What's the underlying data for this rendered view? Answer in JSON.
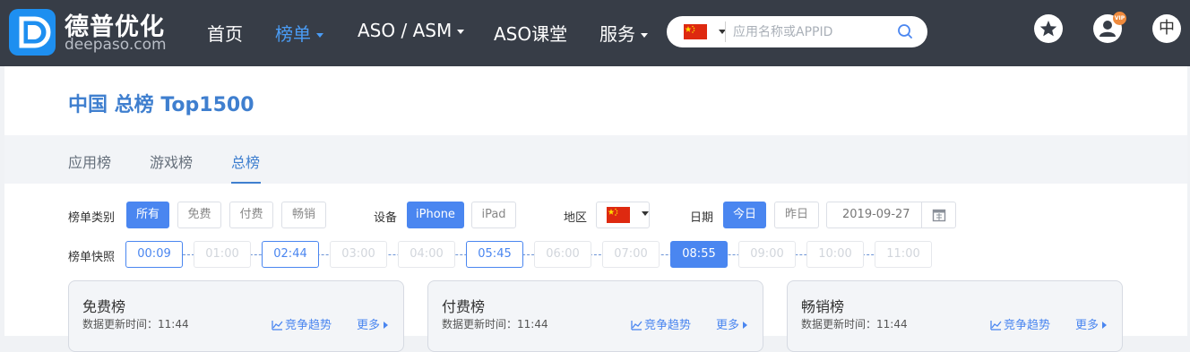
{
  "header": {
    "logo_cn": "德普优化",
    "logo_en": "deepaso.com",
    "nav": [
      {
        "label": "首页"
      },
      {
        "label": "榜单"
      },
      {
        "label": "ASO / ASM"
      },
      {
        "label": "ASO课堂"
      },
      {
        "label": "服务"
      }
    ],
    "search_placeholder": "应用名称或APPID",
    "vip_badge": "VIP",
    "lang": "中"
  },
  "page": {
    "title": "中国 总榜 Top1500",
    "tabs": [
      {
        "label": "应用榜"
      },
      {
        "label": "游戏榜"
      },
      {
        "label": "总榜"
      }
    ]
  },
  "filters": {
    "type_label": "榜单类别",
    "type_options": [
      "所有",
      "免费",
      "付费",
      "畅销"
    ],
    "device_label": "设备",
    "device_options": [
      "iPhone",
      "iPad"
    ],
    "region_label": "地区",
    "date_label": "日期",
    "date_options": [
      "今日",
      "昨日"
    ],
    "date_value": "2019-09-27"
  },
  "snapshot": {
    "label": "榜单快照",
    "times": [
      "00:09",
      "01:00",
      "02:44",
      "03:00",
      "04:00",
      "05:45",
      "06:00",
      "07:00",
      "08:55",
      "09:00",
      "10:00",
      "11:00"
    ]
  },
  "cards": [
    {
      "title": "免费榜",
      "update": "数据更新时间：11:44",
      "trend": "竞争趋势",
      "more": "更多"
    },
    {
      "title": "付费榜",
      "update": "数据更新时间：11:44",
      "trend": "竞争趋势",
      "more": "更多"
    },
    {
      "title": "畅销榜",
      "update": "数据更新时间：11:44",
      "trend": "竞争趋势",
      "more": "更多"
    }
  ],
  "colors": {
    "nav_bg": "#373d47",
    "accent": "#4a86f0",
    "title_blue": "#3f7fcf",
    "vip_orange": "#ef8a3c",
    "flag_red": "#de2910",
    "flag_yellow": "#ffde00"
  }
}
